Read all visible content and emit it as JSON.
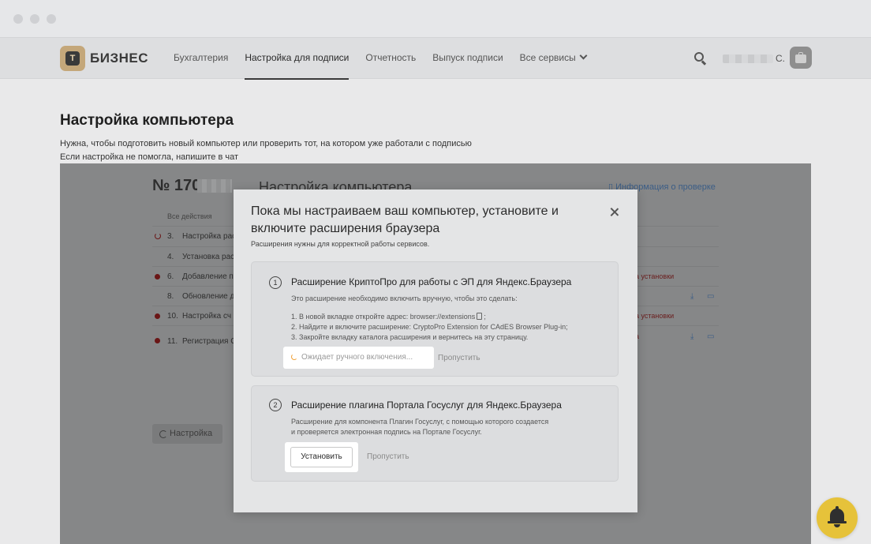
{
  "header": {
    "logo_letter": "Т",
    "logo_text": "БИЗНЕС",
    "nav": [
      {
        "label": "Бухгалтерия"
      },
      {
        "label": "Настройка для подписи"
      },
      {
        "label": "Отчетность"
      },
      {
        "label": "Выпуск подписи"
      },
      {
        "label": "Все сервисы"
      }
    ],
    "user_suffix": "С."
  },
  "page": {
    "title": "Настройка компьютера",
    "description_1": "Нужна, чтобы подготовить новый компьютер или проверить тот, на котором уже работали с подписью",
    "description_2": "Если настройка не помогла, напишите в чат"
  },
  "background_panel": {
    "number_prefix": "№ 170",
    "title": "Настройка компьютера",
    "info_link": "Информация о проверке",
    "column_header": "Все действия",
    "rows": [
      {
        "num": "3.",
        "label": "Настройка рас"
      },
      {
        "num": "4.",
        "label": "Установка рас"
      },
      {
        "num": "6.",
        "label": "Добавление пр"
      },
      {
        "num": "8.",
        "label": "Обновление д"
      },
      {
        "num": "10.",
        "label": "Настройка сч"
      },
      {
        "num": "11.",
        "label": "Регистрация С"
      }
    ],
    "status_fragments": [
      "а установки",
      "а установки",
      "а"
    ],
    "button_label": "Настройка"
  },
  "modal": {
    "title": "Пока мы настраиваем ваш компьютер, установите и включите расширения браузера",
    "subtitle": "Расширения нужны для корректной работы сервисов.",
    "step1": {
      "number": "1",
      "title": "Расширение КриптоПро для работы с ЭП для Яндекс.Браузера",
      "intro": "Это расширение необходимо включить вручную, чтобы это сделать:",
      "instruction_1": "1. В новой вкладке откройте адрес: browser://extensions",
      "instruction_1_tail": ";",
      "instruction_2": "2. Найдите и включите расширение: CryptoPro Extension for CAdES Browser Plug-in;",
      "instruction_3": "3. Закройте вкладку каталога расширения и вернитесь на эту страницу.",
      "status": "Ожидает ручного включения...",
      "skip": "Пропустить"
    },
    "step2": {
      "number": "2",
      "title": "Расширение плагина Портала Госуслуг для Яндекс.Браузера",
      "description_1": "Расширение для компонента Плагин Госуслуг, с помощью которого создается",
      "description_2": "и проверяется электронная подпись на Портале Госуслуг.",
      "install": "Установить",
      "skip": "Пропустить"
    }
  },
  "colors": {
    "accent_yellow": "#e6c23a",
    "spinner_orange": "#f0a23a",
    "overlay": "#868788"
  }
}
